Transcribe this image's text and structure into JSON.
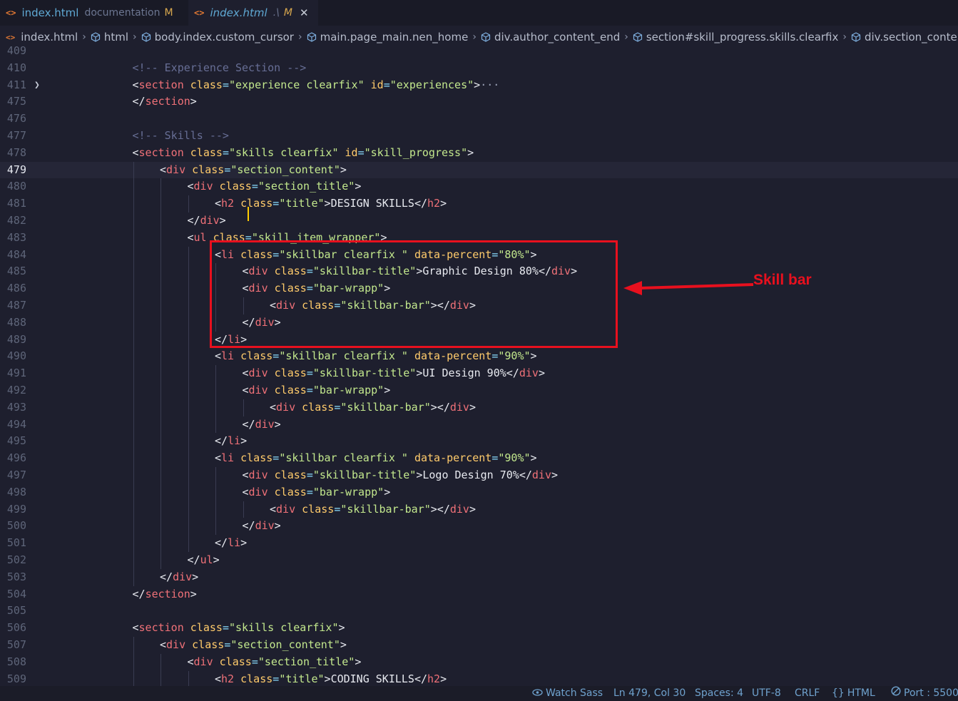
{
  "tabs": [
    {
      "name": "index.html",
      "description": "documentation",
      "status": "M",
      "active": false
    },
    {
      "name": "index.html",
      "description": ".\\",
      "status": "M",
      "active": true
    }
  ],
  "breadcrumb": [
    "index.html",
    "html",
    "body.index.custom_cursor",
    "main.page_main.nen_home",
    "div.author_content_end",
    "section#skill_progress.skills.clearfix",
    "div.section_content"
  ],
  "editor": {
    "current_line": "479",
    "lines": [
      {
        "n": "409",
        "indent": 0,
        "tokens": []
      },
      {
        "n": "410",
        "indent": 3,
        "tokens": [
          [
            "cmt",
            "<!-- Experience Section -->"
          ]
        ]
      },
      {
        "n": "411",
        "indent": 3,
        "fold": true,
        "tokens": [
          [
            "punc",
            "<"
          ],
          [
            "tag",
            "section"
          ],
          [
            "text",
            " "
          ],
          [
            "attr",
            "class"
          ],
          [
            "eq",
            "="
          ],
          [
            "str",
            "\"experience clearfix\""
          ],
          [
            "text",
            " "
          ],
          [
            "attr",
            "id"
          ],
          [
            "eq",
            "="
          ],
          [
            "str",
            "\"experiences\""
          ],
          [
            "punc",
            ">"
          ],
          [
            "ell",
            "···"
          ]
        ]
      },
      {
        "n": "475",
        "indent": 3,
        "tokens": [
          [
            "punc",
            "</"
          ],
          [
            "tag",
            "section"
          ],
          [
            "punc",
            ">"
          ]
        ]
      },
      {
        "n": "476",
        "indent": 0,
        "tokens": []
      },
      {
        "n": "477",
        "indent": 3,
        "tokens": [
          [
            "cmt",
            "<!-- Skills -->"
          ]
        ]
      },
      {
        "n": "478",
        "indent": 3,
        "tokens": [
          [
            "punc",
            "<"
          ],
          [
            "tag",
            "section"
          ],
          [
            "text",
            " "
          ],
          [
            "attr",
            "class"
          ],
          [
            "eq",
            "="
          ],
          [
            "str",
            "\"skills clearfix\""
          ],
          [
            "text",
            " "
          ],
          [
            "attr",
            "id"
          ],
          [
            "eq",
            "="
          ],
          [
            "str",
            "\"skill_progress\""
          ],
          [
            "punc",
            ">"
          ]
        ]
      },
      {
        "n": "479",
        "indent": 4,
        "tokens": [
          [
            "punc",
            "<"
          ],
          [
            "tag",
            "div"
          ],
          [
            "text",
            " "
          ],
          [
            "attr",
            "class"
          ],
          [
            "eq",
            "="
          ],
          [
            "str",
            "\"section_content\""
          ],
          [
            "punc",
            ">"
          ]
        ]
      },
      {
        "n": "480",
        "indent": 5,
        "tokens": [
          [
            "punc",
            "<"
          ],
          [
            "tag",
            "div"
          ],
          [
            "text",
            " "
          ],
          [
            "attr",
            "class"
          ],
          [
            "eq",
            "="
          ],
          [
            "str",
            "\"section_title\""
          ],
          [
            "punc",
            ">"
          ]
        ]
      },
      {
        "n": "481",
        "indent": 6,
        "tokens": [
          [
            "punc",
            "<"
          ],
          [
            "tag",
            "h2"
          ],
          [
            "text",
            " "
          ],
          [
            "attr",
            "class"
          ],
          [
            "eq",
            "="
          ],
          [
            "str",
            "\"title\""
          ],
          [
            "punc",
            ">"
          ],
          [
            "text",
            "DESIGN SKILLS"
          ],
          [
            "punc",
            "</"
          ],
          [
            "tag",
            "h2"
          ],
          [
            "punc",
            ">"
          ]
        ]
      },
      {
        "n": "482",
        "indent": 5,
        "tokens": [
          [
            "punc",
            "</"
          ],
          [
            "tag",
            "div"
          ],
          [
            "punc",
            ">"
          ]
        ]
      },
      {
        "n": "483",
        "indent": 5,
        "tokens": [
          [
            "punc",
            "<"
          ],
          [
            "tag",
            "ul"
          ],
          [
            "text",
            " "
          ],
          [
            "attr",
            "class"
          ],
          [
            "eq",
            "="
          ],
          [
            "str",
            "\"skill_item_wrapper\""
          ],
          [
            "punc",
            ">"
          ]
        ]
      },
      {
        "n": "484",
        "indent": 6,
        "tokens": [
          [
            "punc",
            "<"
          ],
          [
            "tag",
            "li"
          ],
          [
            "text",
            " "
          ],
          [
            "attr",
            "class"
          ],
          [
            "eq",
            "="
          ],
          [
            "str",
            "\"skillbar clearfix \""
          ],
          [
            "text",
            " "
          ],
          [
            "attr",
            "data-percent"
          ],
          [
            "eq",
            "="
          ],
          [
            "str",
            "\"80%\""
          ],
          [
            "punc",
            ">"
          ]
        ]
      },
      {
        "n": "485",
        "indent": 7,
        "tokens": [
          [
            "punc",
            "<"
          ],
          [
            "tag",
            "div"
          ],
          [
            "text",
            " "
          ],
          [
            "attr",
            "class"
          ],
          [
            "eq",
            "="
          ],
          [
            "str",
            "\"skillbar-title\""
          ],
          [
            "punc",
            ">"
          ],
          [
            "text",
            "Graphic Design 80%"
          ],
          [
            "punc",
            "</"
          ],
          [
            "tag",
            "div"
          ],
          [
            "punc",
            ">"
          ]
        ]
      },
      {
        "n": "486",
        "indent": 7,
        "tokens": [
          [
            "punc",
            "<"
          ],
          [
            "tag",
            "div"
          ],
          [
            "text",
            " "
          ],
          [
            "attr",
            "class"
          ],
          [
            "eq",
            "="
          ],
          [
            "str",
            "\"bar-wrapp\""
          ],
          [
            "punc",
            ">"
          ]
        ]
      },
      {
        "n": "487",
        "indent": 8,
        "tokens": [
          [
            "punc",
            "<"
          ],
          [
            "tag",
            "div"
          ],
          [
            "text",
            " "
          ],
          [
            "attr",
            "class"
          ],
          [
            "eq",
            "="
          ],
          [
            "str",
            "\"skillbar-bar\""
          ],
          [
            "punc",
            "></"
          ],
          [
            "tag",
            "div"
          ],
          [
            "punc",
            ">"
          ]
        ]
      },
      {
        "n": "488",
        "indent": 7,
        "tokens": [
          [
            "punc",
            "</"
          ],
          [
            "tag",
            "div"
          ],
          [
            "punc",
            ">"
          ]
        ]
      },
      {
        "n": "489",
        "indent": 6,
        "tokens": [
          [
            "punc",
            "</"
          ],
          [
            "tag",
            "li"
          ],
          [
            "punc",
            ">"
          ]
        ]
      },
      {
        "n": "490",
        "indent": 6,
        "tokens": [
          [
            "punc",
            "<"
          ],
          [
            "tag",
            "li"
          ],
          [
            "text",
            " "
          ],
          [
            "attr",
            "class"
          ],
          [
            "eq",
            "="
          ],
          [
            "str",
            "\"skillbar clearfix \""
          ],
          [
            "text",
            " "
          ],
          [
            "attr",
            "data-percent"
          ],
          [
            "eq",
            "="
          ],
          [
            "str",
            "\"90%\""
          ],
          [
            "punc",
            ">"
          ]
        ]
      },
      {
        "n": "491",
        "indent": 7,
        "tokens": [
          [
            "punc",
            "<"
          ],
          [
            "tag",
            "div"
          ],
          [
            "text",
            " "
          ],
          [
            "attr",
            "class"
          ],
          [
            "eq",
            "="
          ],
          [
            "str",
            "\"skillbar-title\""
          ],
          [
            "punc",
            ">"
          ],
          [
            "text",
            "UI Design 90%"
          ],
          [
            "punc",
            "</"
          ],
          [
            "tag",
            "div"
          ],
          [
            "punc",
            ">"
          ]
        ]
      },
      {
        "n": "492",
        "indent": 7,
        "tokens": [
          [
            "punc",
            "<"
          ],
          [
            "tag",
            "div"
          ],
          [
            "text",
            " "
          ],
          [
            "attr",
            "class"
          ],
          [
            "eq",
            "="
          ],
          [
            "str",
            "\"bar-wrapp\""
          ],
          [
            "punc",
            ">"
          ]
        ]
      },
      {
        "n": "493",
        "indent": 8,
        "tokens": [
          [
            "punc",
            "<"
          ],
          [
            "tag",
            "div"
          ],
          [
            "text",
            " "
          ],
          [
            "attr",
            "class"
          ],
          [
            "eq",
            "="
          ],
          [
            "str",
            "\"skillbar-bar\""
          ],
          [
            "punc",
            "></"
          ],
          [
            "tag",
            "div"
          ],
          [
            "punc",
            ">"
          ]
        ]
      },
      {
        "n": "494",
        "indent": 7,
        "tokens": [
          [
            "punc",
            "</"
          ],
          [
            "tag",
            "div"
          ],
          [
            "punc",
            ">"
          ]
        ]
      },
      {
        "n": "495",
        "indent": 6,
        "tokens": [
          [
            "punc",
            "</"
          ],
          [
            "tag",
            "li"
          ],
          [
            "punc",
            ">"
          ]
        ]
      },
      {
        "n": "496",
        "indent": 6,
        "tokens": [
          [
            "punc",
            "<"
          ],
          [
            "tag",
            "li"
          ],
          [
            "text",
            " "
          ],
          [
            "attr",
            "class"
          ],
          [
            "eq",
            "="
          ],
          [
            "str",
            "\"skillbar clearfix \""
          ],
          [
            "text",
            " "
          ],
          [
            "attr",
            "data-percent"
          ],
          [
            "eq",
            "="
          ],
          [
            "str",
            "\"90%\""
          ],
          [
            "punc",
            ">"
          ]
        ]
      },
      {
        "n": "497",
        "indent": 7,
        "tokens": [
          [
            "punc",
            "<"
          ],
          [
            "tag",
            "div"
          ],
          [
            "text",
            " "
          ],
          [
            "attr",
            "class"
          ],
          [
            "eq",
            "="
          ],
          [
            "str",
            "\"skillbar-title\""
          ],
          [
            "punc",
            ">"
          ],
          [
            "text",
            "Logo Design 70%"
          ],
          [
            "punc",
            "</"
          ],
          [
            "tag",
            "div"
          ],
          [
            "punc",
            ">"
          ]
        ]
      },
      {
        "n": "498",
        "indent": 7,
        "tokens": [
          [
            "punc",
            "<"
          ],
          [
            "tag",
            "div"
          ],
          [
            "text",
            " "
          ],
          [
            "attr",
            "class"
          ],
          [
            "eq",
            "="
          ],
          [
            "str",
            "\"bar-wrapp\""
          ],
          [
            "punc",
            ">"
          ]
        ]
      },
      {
        "n": "499",
        "indent": 8,
        "tokens": [
          [
            "punc",
            "<"
          ],
          [
            "tag",
            "div"
          ],
          [
            "text",
            " "
          ],
          [
            "attr",
            "class"
          ],
          [
            "eq",
            "="
          ],
          [
            "str",
            "\"skillbar-bar\""
          ],
          [
            "punc",
            "></"
          ],
          [
            "tag",
            "div"
          ],
          [
            "punc",
            ">"
          ]
        ]
      },
      {
        "n": "500",
        "indent": 7,
        "tokens": [
          [
            "punc",
            "</"
          ],
          [
            "tag",
            "div"
          ],
          [
            "punc",
            ">"
          ]
        ]
      },
      {
        "n": "501",
        "indent": 6,
        "tokens": [
          [
            "punc",
            "</"
          ],
          [
            "tag",
            "li"
          ],
          [
            "punc",
            ">"
          ]
        ]
      },
      {
        "n": "502",
        "indent": 5,
        "tokens": [
          [
            "punc",
            "</"
          ],
          [
            "tag",
            "ul"
          ],
          [
            "punc",
            ">"
          ]
        ]
      },
      {
        "n": "503",
        "indent": 4,
        "tokens": [
          [
            "punc",
            "</"
          ],
          [
            "tag",
            "div"
          ],
          [
            "punc",
            ">"
          ]
        ]
      },
      {
        "n": "504",
        "indent": 3,
        "tokens": [
          [
            "punc",
            "</"
          ],
          [
            "tag",
            "section"
          ],
          [
            "punc",
            ">"
          ]
        ]
      },
      {
        "n": "505",
        "indent": 0,
        "tokens": []
      },
      {
        "n": "506",
        "indent": 3,
        "tokens": [
          [
            "punc",
            "<"
          ],
          [
            "tag",
            "section"
          ],
          [
            "text",
            " "
          ],
          [
            "attr",
            "class"
          ],
          [
            "eq",
            "="
          ],
          [
            "str",
            "\"skills clearfix\""
          ],
          [
            "punc",
            ">"
          ]
        ]
      },
      {
        "n": "507",
        "indent": 4,
        "tokens": [
          [
            "punc",
            "<"
          ],
          [
            "tag",
            "div"
          ],
          [
            "text",
            " "
          ],
          [
            "attr",
            "class"
          ],
          [
            "eq",
            "="
          ],
          [
            "str",
            "\"section_content\""
          ],
          [
            "punc",
            ">"
          ]
        ]
      },
      {
        "n": "508",
        "indent": 5,
        "tokens": [
          [
            "punc",
            "<"
          ],
          [
            "tag",
            "div"
          ],
          [
            "text",
            " "
          ],
          [
            "attr",
            "class"
          ],
          [
            "eq",
            "="
          ],
          [
            "str",
            "\"section_title\""
          ],
          [
            "punc",
            ">"
          ]
        ]
      },
      {
        "n": "509",
        "indent": 6,
        "tokens": [
          [
            "punc",
            "<"
          ],
          [
            "tag",
            "h2"
          ],
          [
            "text",
            " "
          ],
          [
            "attr",
            "class"
          ],
          [
            "eq",
            "="
          ],
          [
            "str",
            "\"title\""
          ],
          [
            "punc",
            ">"
          ],
          [
            "text",
            "CODING SKILLS"
          ],
          [
            "punc",
            "</"
          ],
          [
            "tag",
            "h2"
          ],
          [
            "punc",
            ">"
          ]
        ]
      }
    ]
  },
  "annotation": {
    "label": "Skill bar",
    "color": "#e8101e"
  },
  "statusbar": {
    "watch_sass": "Watch Sass",
    "position": "Ln 479, Col 30",
    "spaces": "Spaces: 4",
    "encoding": "UTF-8",
    "eol": "CRLF",
    "language": "HTML",
    "port": "Port : 5500"
  },
  "colors": {
    "background": "#1e1f2e",
    "tag": "#f07178",
    "attribute": "#ffcb6b",
    "string": "#c3e88d",
    "comment": "#676e95",
    "accent": "#6fa2ce"
  }
}
